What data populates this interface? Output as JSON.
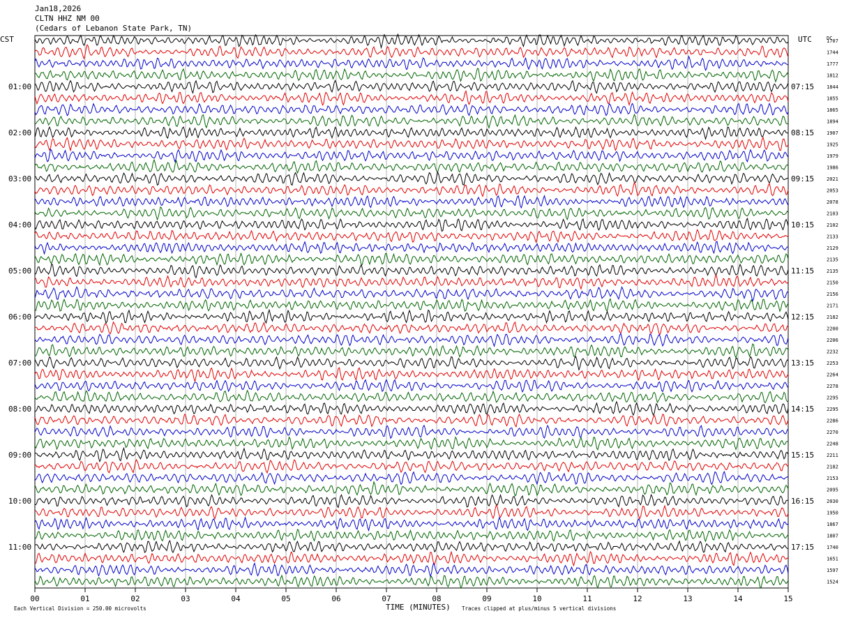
{
  "header": {
    "date": "Jan18,2026",
    "station": "CLTN HHZ NM 00",
    "location": "(Cedars of Lebanon State Park, TN)"
  },
  "axis": {
    "left_zone": "CST",
    "right_zone": "UTC",
    "dc_header": "DC",
    "xlabel": "TIME (MINUTES)"
  },
  "footer": {
    "scale_note": "Each Vertical Division =  250.00 microvolts",
    "clip_note": "Traces clipped at plus/minus 5 vertical divisions"
  },
  "colors": {
    "trace_cycle": [
      "#000000",
      "#e00000",
      "#0000c8",
      "#006400"
    ],
    "gridline": "#808080"
  },
  "chart_data": {
    "type": "line",
    "title": "Jan18,2026 CLTN HHZ NM 00 (Cedars of Lebanon State Park, TN)",
    "xlabel": "TIME (MINUTES)",
    "xlim": [
      0,
      15
    ],
    "x_ticks": [
      "00",
      "01",
      "02",
      "03",
      "04",
      "05",
      "06",
      "07",
      "08",
      "09",
      "10",
      "11",
      "12",
      "13",
      "14",
      "15"
    ],
    "trace_minutes": 15,
    "left_hour_labels": [
      {
        "row": 4,
        "text": "01:00"
      },
      {
        "row": 8,
        "text": "02:00"
      },
      {
        "row": 12,
        "text": "03:00"
      },
      {
        "row": 16,
        "text": "04:00"
      },
      {
        "row": 20,
        "text": "05:00"
      },
      {
        "row": 24,
        "text": "06:00"
      },
      {
        "row": 28,
        "text": "07:00"
      },
      {
        "row": 32,
        "text": "08:00"
      },
      {
        "row": 36,
        "text": "09:00"
      },
      {
        "row": 40,
        "text": "10:00"
      },
      {
        "row": 44,
        "text": "11:00"
      }
    ],
    "right_hour_labels": [
      {
        "row": 4,
        "text": "07:15"
      },
      {
        "row": 8,
        "text": "08:15"
      },
      {
        "row": 12,
        "text": "09:15"
      },
      {
        "row": 16,
        "text": "10:15"
      },
      {
        "row": 20,
        "text": "11:15"
      },
      {
        "row": 24,
        "text": "12:15"
      },
      {
        "row": 28,
        "text": "13:15"
      },
      {
        "row": 32,
        "text": "14:15"
      },
      {
        "row": 36,
        "text": "15:15"
      },
      {
        "row": 40,
        "text": "16:15"
      },
      {
        "row": 44,
        "text": "17:15"
      }
    ],
    "dc_offsets": [
      1707,
      1744,
      1777,
      1812,
      1844,
      1855,
      1865,
      1894,
      1907,
      1925,
      1979,
      1986,
      2021,
      2053,
      2078,
      2103,
      2102,
      2133,
      2129,
      2135,
      2135,
      2150,
      2156,
      2171,
      2182,
      2200,
      2206,
      2232,
      2253,
      2264,
      2278,
      2295,
      2295,
      2286,
      2270,
      2248,
      2211,
      2182,
      2153,
      2095,
      2030,
      1950,
      1867,
      1807,
      1740,
      1651,
      1597,
      1524
    ],
    "units": "microvolts",
    "vertical_division_uV": 250.0,
    "clip_divisions": 5
  }
}
